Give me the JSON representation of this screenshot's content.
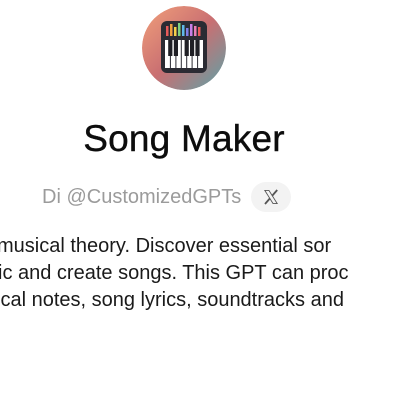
{
  "gpt": {
    "name": "Song Maker",
    "author": "Di @CustomizedGPTs",
    "x_icon": "x-logo-icon",
    "description_lines": [
      "musical theory. Discover essential sor",
      "ic and create songs. This GPT can proc",
      "ical notes, song lyrics, soundtracks and"
    ]
  },
  "colors": {
    "title": "#0d0d0d",
    "author": "#9b9b9b",
    "x_button_bg": "#f3f3f3",
    "description": "#1a1a1a"
  }
}
